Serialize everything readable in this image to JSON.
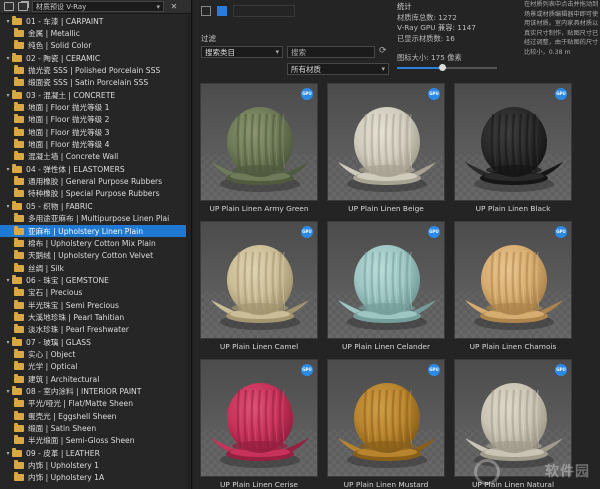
{
  "toolbar": {
    "library_value": "材质预设 V-Ray",
    "close_label": "✕"
  },
  "tree": [
    {
      "kind": "cat",
      "label": "01 - 车漆 | CARPAINT",
      "open": true
    },
    {
      "kind": "sub",
      "label": "金属 | Metallic"
    },
    {
      "kind": "sub",
      "label": "纯色 | Solid Color"
    },
    {
      "kind": "cat",
      "label": "02 - 陶瓷 | CERAMIC",
      "open": true
    },
    {
      "kind": "sub",
      "label": "抛光瓷 SSS | Polished Porcelain SSS"
    },
    {
      "kind": "sub",
      "label": "缎面瓷 SSS | Satin Porcelain SSS"
    },
    {
      "kind": "cat",
      "label": "03 - 混凝土 | CONCRETE",
      "open": true
    },
    {
      "kind": "sub",
      "label": "地面 | Floor 抛光等级 1"
    },
    {
      "kind": "sub",
      "label": "地面 | Floor 抛光等级 2"
    },
    {
      "kind": "sub",
      "label": "地面 | Floor 抛光等级 3"
    },
    {
      "kind": "sub",
      "label": "地面 | Floor 抛光等级 4"
    },
    {
      "kind": "sub",
      "label": "混凝土墙 | Concrete Wall"
    },
    {
      "kind": "cat",
      "label": "04 - 弹性体 | ELASTOMERS",
      "open": true
    },
    {
      "kind": "sub",
      "label": "通用橡胶 | General Purpose Rubbers"
    },
    {
      "kind": "sub",
      "label": "特种橡胶 | Special Purpose Rubbers"
    },
    {
      "kind": "cat",
      "label": "05 - 织物 | FABRIC",
      "open": true
    },
    {
      "kind": "sub",
      "label": "多用途亚麻布 | Multipurpose Linen Plai"
    },
    {
      "kind": "sub",
      "label": "亚麻布 | Upholstery Linen Plain",
      "selected": true
    },
    {
      "kind": "sub",
      "label": "棉布 | Upholstery Cotton Mix Plain"
    },
    {
      "kind": "sub",
      "label": "天鹅绒 | Upholstery Cotton Velvet"
    },
    {
      "kind": "sub",
      "label": "丝绸 | Silk"
    },
    {
      "kind": "cat",
      "label": "06 - 珠宝 | GEMSTONE",
      "open": true
    },
    {
      "kind": "sub",
      "label": "宝石 | Precious"
    },
    {
      "kind": "sub",
      "label": "半光珠宝 | Semi Precious"
    },
    {
      "kind": "sub",
      "label": "大溪地珍珠 | Pearl Tahitian"
    },
    {
      "kind": "sub",
      "label": "淡水珍珠 | Pearl Freshwater"
    },
    {
      "kind": "cat",
      "label": "07 - 玻璃 | GLASS",
      "open": true
    },
    {
      "kind": "sub",
      "label": "实心 | Object"
    },
    {
      "kind": "sub",
      "label": "光学 | Optical"
    },
    {
      "kind": "sub",
      "label": "建筑 | Architectural"
    },
    {
      "kind": "cat",
      "label": "08 - 室内涂料 | INTERIOR PAINT",
      "open": true
    },
    {
      "kind": "sub",
      "label": "平光/哑光 | Flat/Matte Sheen"
    },
    {
      "kind": "sub",
      "label": "蛋壳光 | Eggshell Sheen"
    },
    {
      "kind": "sub",
      "label": "缎面 | Satin Sheen"
    },
    {
      "kind": "sub",
      "label": "半光缎面 | Semi-Gloss Sheen"
    },
    {
      "kind": "cat",
      "label": "09 - 皮革 | LEATHER",
      "open": true
    },
    {
      "kind": "sub",
      "label": "内饰 | Upholstery 1"
    },
    {
      "kind": "sub",
      "label": "内饰 | Upholstery 1A"
    }
  ],
  "filter": {
    "title": "过滤",
    "category_value": "搜索类目",
    "search_placeholder": "搜索",
    "material_value": "所有材质"
  },
  "stats": {
    "header": "统计",
    "total": "材质库总数: 1272",
    "gpu": "V-Ray GPU 兼容: 1147",
    "shown": "已显示材质数: 16"
  },
  "slider": {
    "label": "图标大小: 175 像素",
    "fraction": 0.45
  },
  "help_text": "在材质列表中点击并拖动到场景或材质编辑器中即可使用该材质。室内家具材质以真实尺寸制作，贴图尺寸已经过调整，由于贴图的尺寸比较小，0.38 m",
  "badge_label": "GPU",
  "materials": [
    {
      "name": "UP Plain Linen Army Green",
      "color": "#6f7a58",
      "shade": "#505a3e",
      "light": "#8b9670"
    },
    {
      "name": "UP Plain Linen Beige",
      "color": "#cfcbbd",
      "shade": "#a7a392",
      "light": "#e4e1d4"
    },
    {
      "name": "UP Plain Linen Black",
      "color": "#2a2a2a",
      "shade": "#161616",
      "light": "#3d3d3d"
    },
    {
      "name": "UP Plain Linen Camel",
      "color": "#cbbd97",
      "shade": "#a3956f",
      "light": "#dfd3b1"
    },
    {
      "name": "UP Plain Linen Celander",
      "color": "#9dc5c2",
      "shade": "#759e9b",
      "light": "#b9dcd9"
    },
    {
      "name": "UP Plain Linen Chamois",
      "color": "#d7ac70",
      "shade": "#ac844c",
      "light": "#e8c58e"
    },
    {
      "name": "UP Plain Linen Cerise",
      "color": "#c8325a",
      "shade": "#96203f",
      "light": "#de5276"
    },
    {
      "name": "UP Plain Linen Mustard",
      "color": "#b8842e",
      "shade": "#8a6019",
      "light": "#d09d46"
    },
    {
      "name": "UP Plain Linen Natural",
      "color": "#c9c4b4",
      "shade": "#a09b8b",
      "light": "#deD9ca"
    }
  ],
  "watermark": "软件园"
}
